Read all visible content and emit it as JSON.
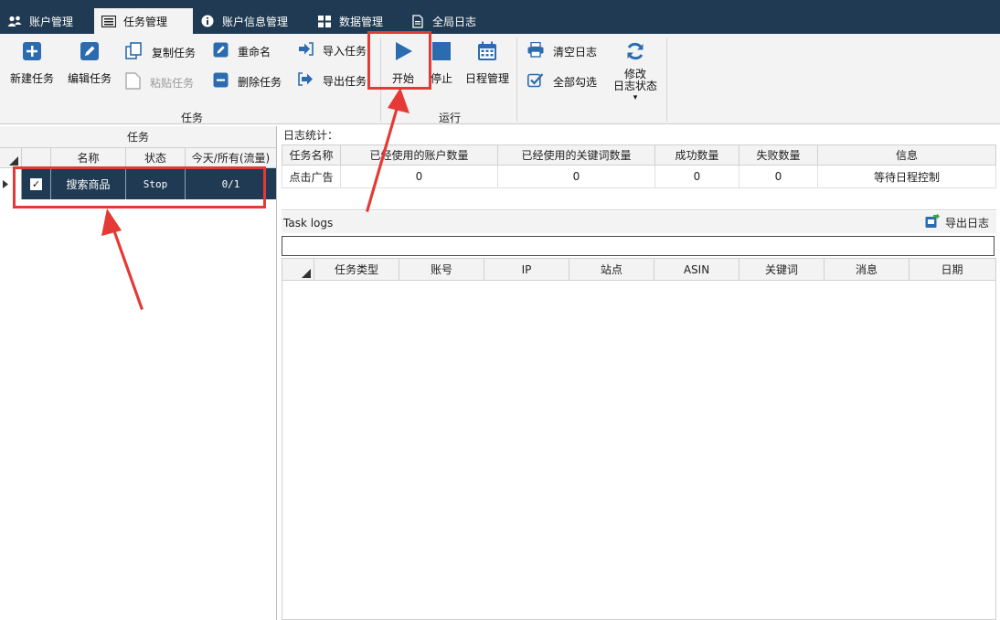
{
  "tabs": [
    {
      "label": "账户管理",
      "icon": "users-icon",
      "active": false
    },
    {
      "label": "任务管理",
      "icon": "list-icon",
      "active": true
    },
    {
      "label": "账户信息管理",
      "icon": "info-icon",
      "active": false
    },
    {
      "label": "数据管理",
      "icon": "grid-icon",
      "active": false
    },
    {
      "label": "全局日志",
      "icon": "document-icon",
      "active": false
    }
  ],
  "ribbon": {
    "new_task": "新建任务",
    "edit_task": "编辑任务",
    "copy_task": "复制任务",
    "paste_task": "粘贴任务",
    "rename": "重命名",
    "delete_task": "删除任务",
    "import_task": "导入任务",
    "export_task": "导出任务",
    "group_task": "任务",
    "start": "开始",
    "stop": "停止",
    "schedule": "日程管理",
    "group_run": "运行",
    "clear_log": "清空日志",
    "check_all": "全部勾选",
    "modify_line1": "修改",
    "modify_line2": "日志状态",
    "dropdown_glyph": "▾"
  },
  "task_panel": {
    "title": "任务",
    "columns": [
      "名称",
      "状态",
      "今天/所有(流量)"
    ],
    "rows": [
      {
        "checked": "✓",
        "name": "搜索商品",
        "status": "Stop",
        "count": "0/1"
      }
    ]
  },
  "stats": {
    "label": "日志统计：",
    "columns": [
      "任务名称",
      "已经使用的账户数量",
      "已经使用的关键词数量",
      "成功数量",
      "失败数量",
      "信息"
    ],
    "row": [
      "点击广告",
      "0",
      "0",
      "0",
      "0",
      "等待日程控制"
    ]
  },
  "logs": {
    "title": "Task logs",
    "export_label": "导出日志",
    "search_value": "",
    "columns": [
      "任务类型",
      "账号",
      "IP",
      "站点",
      "ASIN",
      "关键词",
      "消息",
      "日期"
    ]
  },
  "colors": {
    "tabbar": "#1f3a52",
    "accent_blue": "#2b6cb0",
    "highlight": "#e53935"
  }
}
